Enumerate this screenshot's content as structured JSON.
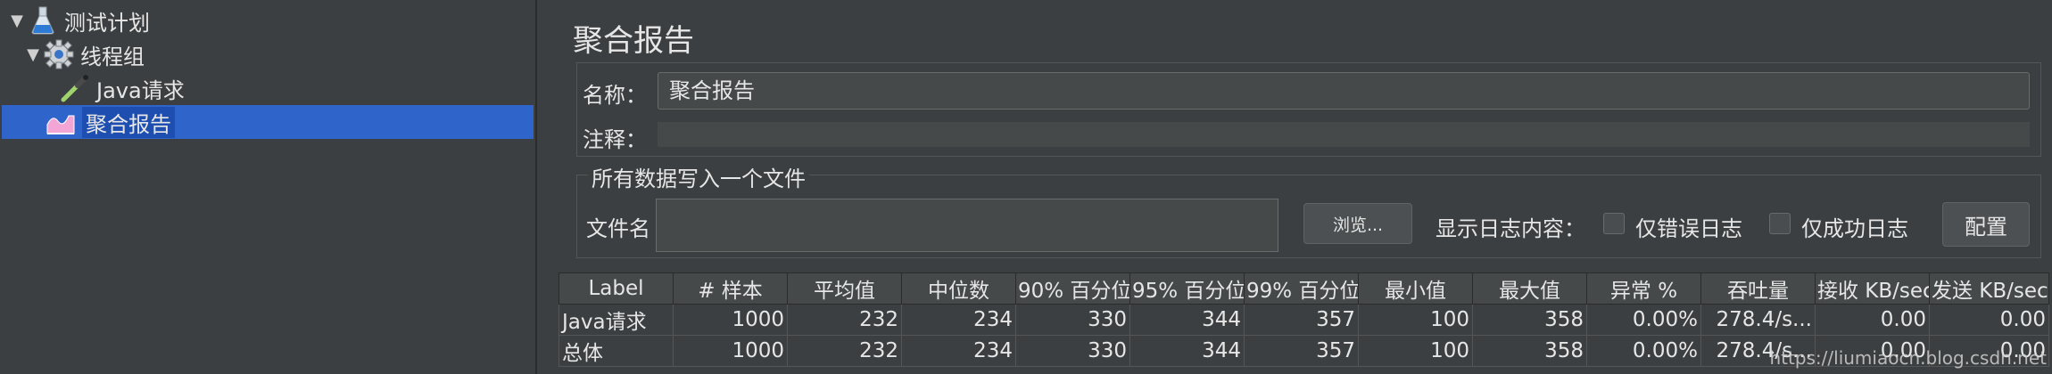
{
  "tree": {
    "items": [
      {
        "label": "测试计划",
        "icon": "flask-icon",
        "expanded": true
      },
      {
        "label": "线程组",
        "icon": "gear-icon",
        "expanded": true
      },
      {
        "label": "Java请求",
        "icon": "dropper-icon"
      },
      {
        "label": "聚合报告",
        "icon": "chart-icon",
        "selected": true
      }
    ]
  },
  "panel": {
    "title": "聚合报告",
    "name_label": "名称：",
    "name_value": "聚合报告",
    "comment_label": "注释：",
    "comment_value": "",
    "file_section_title": "所有数据写入一个文件",
    "filename_label": "文件名",
    "filename_value": "",
    "browse_label": "浏览...",
    "log_content_label": "显示日志内容：",
    "errors_only_label": "仅错误日志",
    "success_only_label": "仅成功日志",
    "config_label": "配置"
  },
  "table": {
    "headers": [
      "Label",
      "# 样本",
      "平均值",
      "中位数",
      "90% 百分位",
      "95% 百分位",
      "99% 百分位",
      "最小值",
      "最大值",
      "异常 %",
      "吞吐量",
      "接收 KB/sec",
      "发送 KB/sec"
    ],
    "rows": [
      [
        "Java请求",
        "1000",
        "232",
        "234",
        "330",
        "344",
        "357",
        "100",
        "358",
        "0.00%",
        "278.4/s...",
        "0.00",
        "0.00"
      ],
      [
        "总体",
        "1000",
        "232",
        "234",
        "330",
        "344",
        "357",
        "100",
        "358",
        "0.00%",
        "278.4/s...",
        "0.00",
        "0.00"
      ]
    ]
  },
  "watermark": "https://liumiaocn.blog.csdn.net",
  "colors": {
    "selection": "#2f65ca",
    "background": "#3c3f41",
    "field": "#45494a"
  }
}
